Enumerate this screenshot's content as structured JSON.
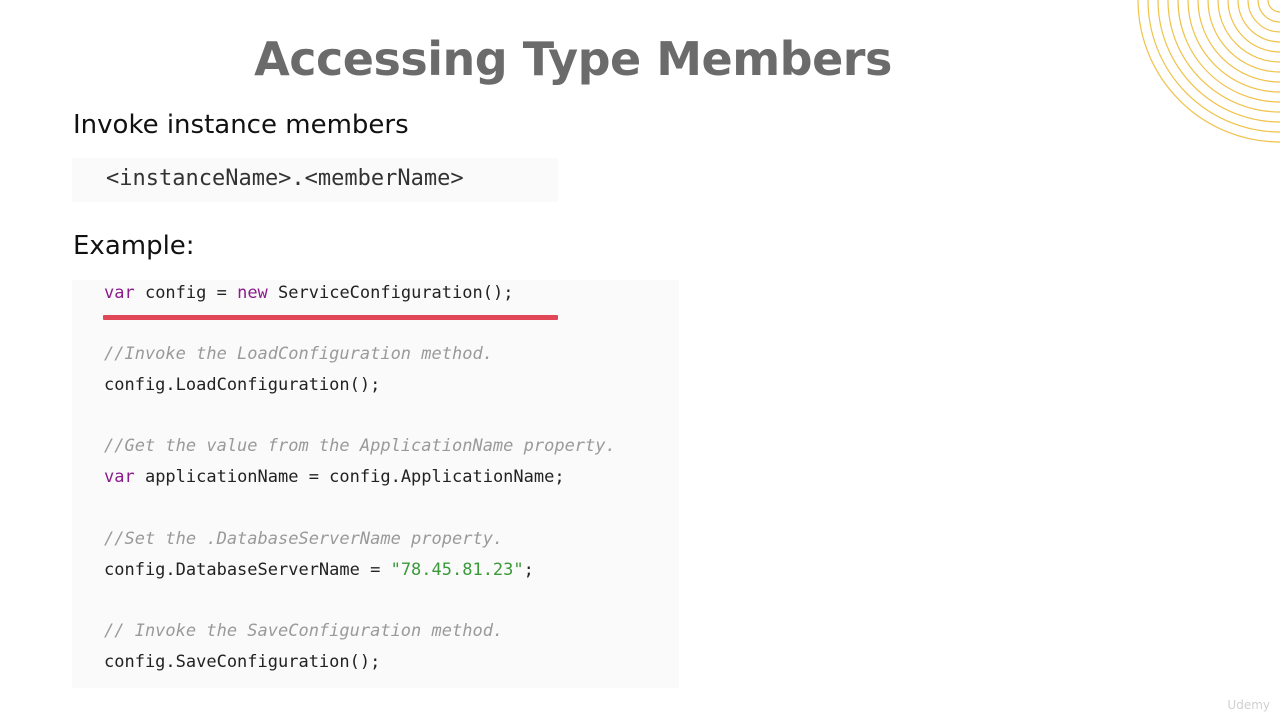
{
  "slide": {
    "title": "Accessing Type Members",
    "subheading": "Invoke instance members",
    "syntax": "<instanceName>.<memberName>",
    "example_label": "Example:",
    "watermark": "Udemy"
  },
  "code": {
    "line1": {
      "kw1": "var",
      "a": " config = ",
      "kw2": "new",
      "b": " ServiceConfiguration();"
    },
    "comment1": "//Invoke the LoadConfiguration method.",
    "line2": "config.LoadConfiguration();",
    "comment2": "//Get the value from the ApplicationName property.",
    "line3": {
      "kw": "var",
      "rest": " applicationName = config.ApplicationName;"
    },
    "comment3": "//Set the .DatabaseServerName property.",
    "line4": {
      "a": "config.DatabaseServerName = ",
      "str": "\"78.45.81.23\"",
      "b": ";"
    },
    "comment4": "// Invoke the SaveConfiguration method.",
    "line5": "config.SaveConfiguration();"
  },
  "colors": {
    "keyword": "#8b1d8b",
    "comment": "#9a9a9a",
    "string": "#3a9a3a",
    "highlight_underline": "#e04858",
    "decoration_rings": "#f0c24a"
  }
}
